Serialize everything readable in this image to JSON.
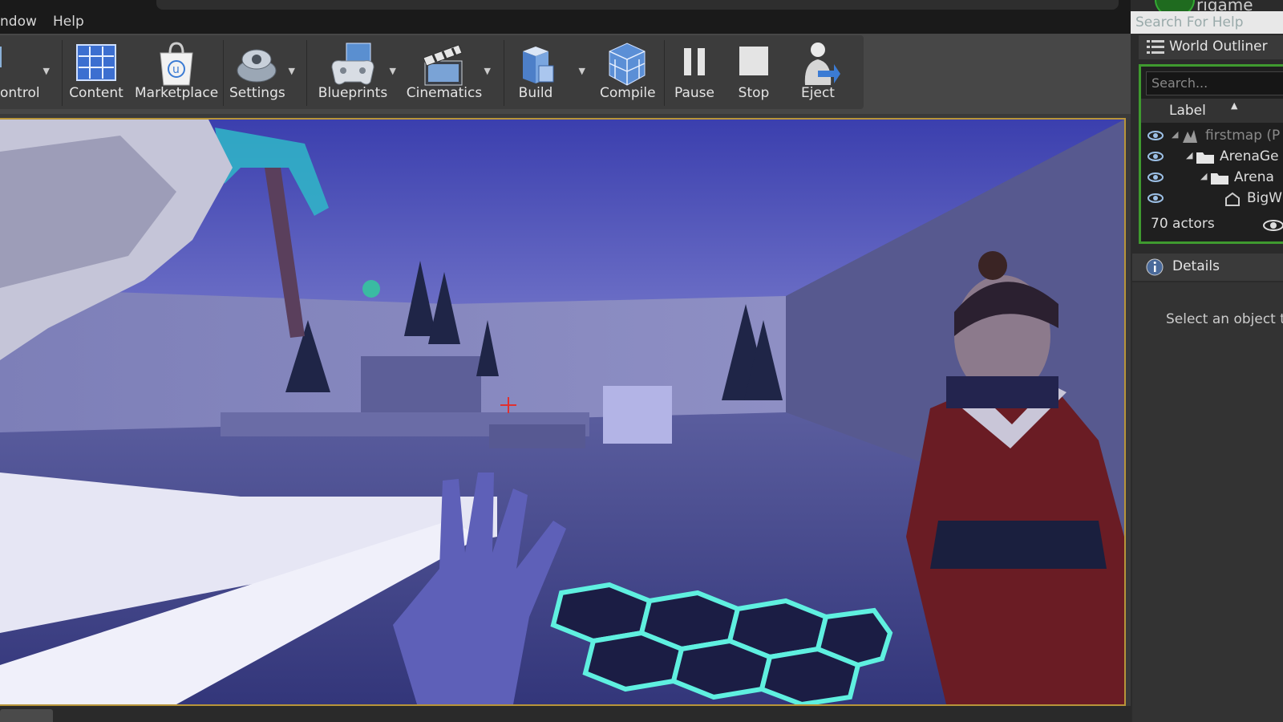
{
  "menubar": {
    "items": [
      "ndow",
      "Help"
    ]
  },
  "toolbar": {
    "buttons": [
      {
        "label": "ontrol",
        "icon": "source-control-icon",
        "dropdown": true
      },
      {
        "label": "Content",
        "icon": "content-browser-icon",
        "dropdown": false
      },
      {
        "label": "Marketplace",
        "icon": "marketplace-icon",
        "dropdown": false
      },
      {
        "label": "Settings",
        "icon": "settings-gear-icon",
        "dropdown": true
      },
      {
        "label": "Blueprints",
        "icon": "blueprints-gamepad-icon",
        "dropdown": true
      },
      {
        "label": "Cinematics",
        "icon": "clapperboard-icon",
        "dropdown": true
      },
      {
        "label": "Build",
        "icon": "build-blocks-icon",
        "dropdown": true
      },
      {
        "label": "Compile",
        "icon": "compile-cubes-icon",
        "dropdown": false
      },
      {
        "label": "Pause",
        "icon": "pause-icon",
        "dropdown": false
      },
      {
        "label": "Stop",
        "icon": "stop-icon",
        "dropdown": false
      },
      {
        "label": "Eject",
        "icon": "eject-person-icon",
        "dropdown": false
      }
    ]
  },
  "help_search": {
    "placeholder": "Search For Help"
  },
  "project": {
    "name": "rigame"
  },
  "outliner": {
    "title": "World Outliner",
    "search_placeholder": "Search...",
    "column_label": "Label",
    "rows": [
      {
        "label": "firstmap (P",
        "icon": "map-icon",
        "indent": 0
      },
      {
        "label": "ArenaGe",
        "icon": "folder-icon",
        "indent": 1
      },
      {
        "label": "Arena",
        "icon": "folder-icon",
        "indent": 2
      },
      {
        "label": "BigW",
        "icon": "actor-icon",
        "indent": 3
      }
    ],
    "actor_count": "70 actors"
  },
  "details": {
    "title": "Details",
    "empty_text": "Select an object to"
  },
  "colors": {
    "viewport_border": "#b8953a",
    "outliner_focus": "#3f9a2f",
    "sky_top": "#3b3fae",
    "sky_bottom": "#a9abde",
    "hex_glow": "#5ff0e0"
  }
}
